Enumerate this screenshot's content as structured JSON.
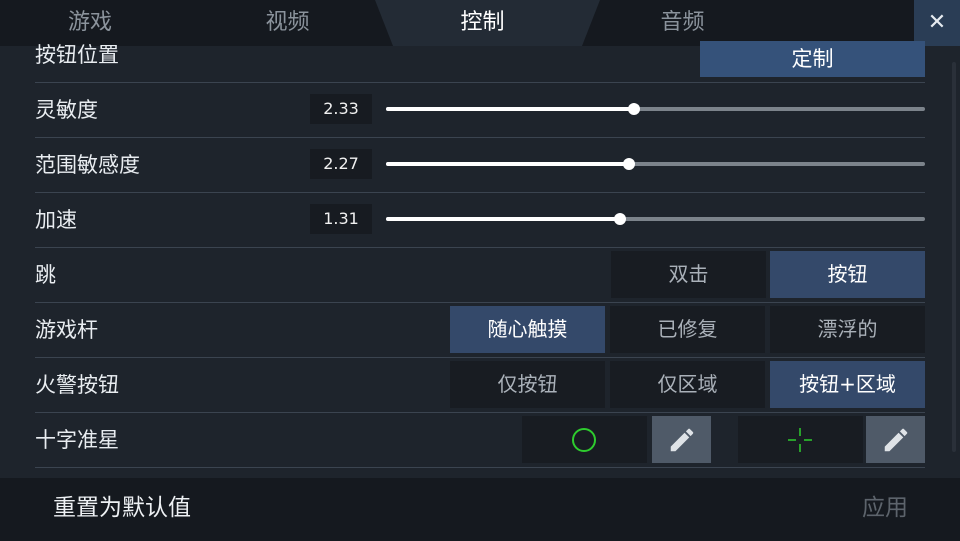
{
  "tabs": [
    {
      "label": "游戏"
    },
    {
      "label": "视频"
    },
    {
      "label": "控制",
      "active": true
    },
    {
      "label": "音频"
    }
  ],
  "close_label": "✕",
  "rows": {
    "button_position": {
      "label": "按钮位置",
      "button": "定制"
    },
    "sensitivity": {
      "label": "灵敏度",
      "value": "2.33",
      "fraction": 0.46
    },
    "range_sensitivity": {
      "label": "范围敏感度",
      "value": "2.27",
      "fraction": 0.45
    },
    "acceleration": {
      "label": "加速",
      "value": "1.31",
      "fraction": 0.435
    },
    "jump": {
      "label": "跳",
      "options": [
        "双击",
        "按钮"
      ],
      "selected": 1
    },
    "joystick": {
      "label": "游戏杆",
      "options": [
        "随心触摸",
        "已修复",
        "漂浮的"
      ],
      "selected": 0
    },
    "fire_button": {
      "label": "火警按钮",
      "options": [
        "仅按钮",
        "仅区域",
        "按钮+区域"
      ],
      "selected": 2
    },
    "crosshair": {
      "label": "十字准星"
    }
  },
  "colors": {
    "accent": "#35527a",
    "crosshair_green": "#2ecc2e"
  },
  "footer": {
    "reset": "重置为默认值",
    "apply": "应用"
  }
}
